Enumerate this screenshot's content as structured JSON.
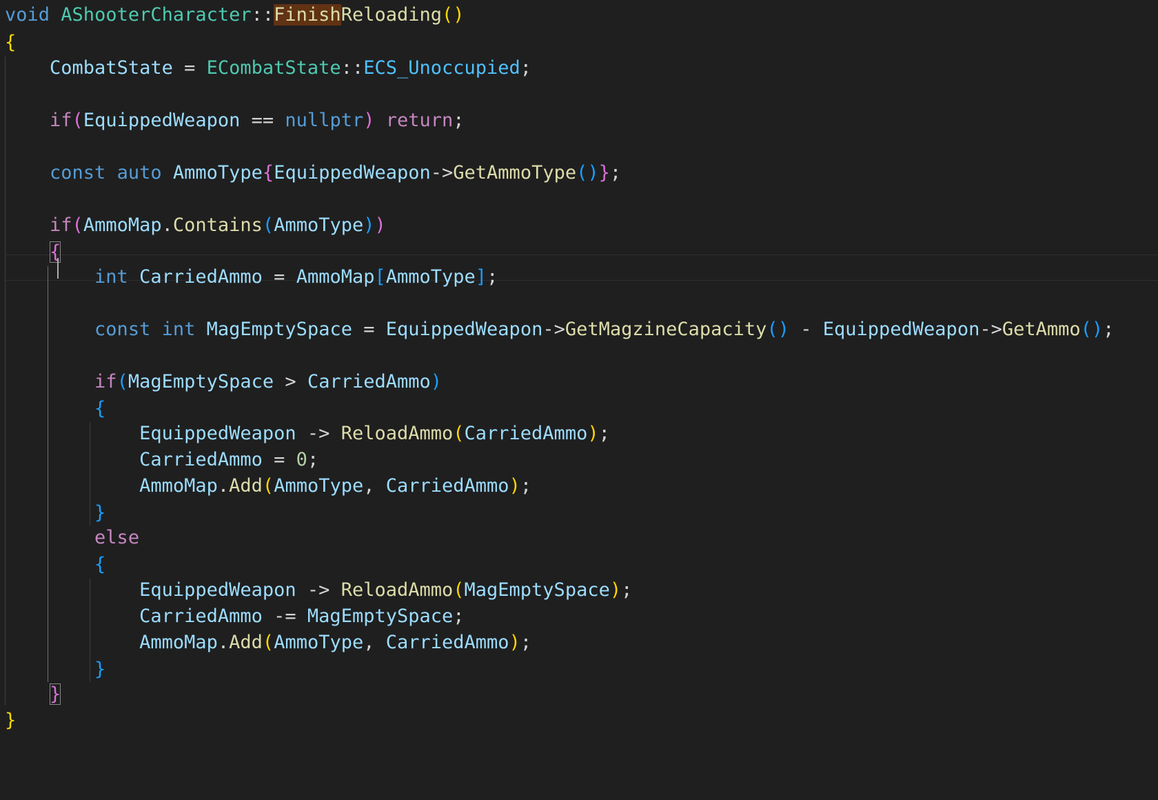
{
  "colors": {
    "background": "#1f1f1f",
    "keyword": "#569cd6",
    "control": "#c586c0",
    "type": "#4ec9b0",
    "function": "#dcdcaa",
    "variable": "#9cdcfe",
    "enum_member": "#4fc1ff",
    "number": "#b5cea8",
    "operator": "#d4d4d4",
    "bracket_gold": "#ffd700",
    "bracket_pink": "#da70d6",
    "bracket_blue": "#179fff",
    "find_highlight": "#613214"
  },
  "code": {
    "lines": [
      {
        "tokens": [
          {
            "t": "void",
            "c": "keyword"
          },
          {
            "t": " "
          },
          {
            "t": "AShooterCharacter",
            "c": "type"
          },
          {
            "t": "::",
            "c": "operator"
          },
          {
            "t": "Finish",
            "c": "function",
            "h": 1
          },
          {
            "t": "Reloading",
            "c": "function"
          },
          {
            "t": "()",
            "c": "bracket_gold"
          }
        ]
      },
      {
        "tokens": [
          {
            "t": "{",
            "c": "bracket_gold"
          }
        ]
      },
      {
        "tokens": [
          {
            "t": "    "
          },
          {
            "t": "CombatState",
            "c": "variable"
          },
          {
            "t": " = ",
            "c": "operator"
          },
          {
            "t": "ECombatState",
            "c": "type"
          },
          {
            "t": "::",
            "c": "operator"
          },
          {
            "t": "ECS_Unoccupied",
            "c": "enum_member"
          },
          {
            "t": ";",
            "c": "operator"
          }
        ]
      },
      {
        "tokens": []
      },
      {
        "tokens": [
          {
            "t": "    "
          },
          {
            "t": "if",
            "c": "control"
          },
          {
            "t": "(",
            "c": "bracket_pink"
          },
          {
            "t": "EquippedWeapon",
            "c": "variable"
          },
          {
            "t": " == ",
            "c": "operator"
          },
          {
            "t": "nullptr",
            "c": "keyword"
          },
          {
            "t": ")",
            "c": "bracket_pink"
          },
          {
            "t": " "
          },
          {
            "t": "return",
            "c": "control"
          },
          {
            "t": ";",
            "c": "operator"
          }
        ]
      },
      {
        "tokens": []
      },
      {
        "tokens": [
          {
            "t": "    "
          },
          {
            "t": "const",
            "c": "keyword"
          },
          {
            "t": " "
          },
          {
            "t": "auto",
            "c": "keyword"
          },
          {
            "t": " "
          },
          {
            "t": "AmmoType",
            "c": "variable"
          },
          {
            "t": "{",
            "c": "bracket_pink"
          },
          {
            "t": "EquippedWeapon",
            "c": "variable"
          },
          {
            "t": "->",
            "c": "operator"
          },
          {
            "t": "GetAmmoType",
            "c": "function"
          },
          {
            "t": "()",
            "c": "bracket_blue"
          },
          {
            "t": "}",
            "c": "bracket_pink"
          },
          {
            "t": ";",
            "c": "operator"
          }
        ]
      },
      {
        "tokens": []
      },
      {
        "tokens": [
          {
            "t": "    "
          },
          {
            "t": "if",
            "c": "control"
          },
          {
            "t": "(",
            "c": "bracket_pink"
          },
          {
            "t": "AmmoMap",
            "c": "variable"
          },
          {
            "t": ".",
            "c": "operator"
          },
          {
            "t": "Contains",
            "c": "function"
          },
          {
            "t": "(",
            "c": "bracket_blue"
          },
          {
            "t": "AmmoType",
            "c": "variable"
          },
          {
            "t": ")",
            "c": "bracket_blue"
          },
          {
            "t": ")",
            "c": "bracket_pink"
          }
        ]
      },
      {
        "tokens": [
          {
            "t": "    "
          },
          {
            "t": "{",
            "c": "bracket_pink",
            "box": 1
          }
        ]
      },
      {
        "tokens": [
          {
            "t": "        "
          },
          {
            "t": "int",
            "c": "keyword"
          },
          {
            "t": " "
          },
          {
            "t": "CarriedAmmo",
            "c": "variable"
          },
          {
            "t": " = ",
            "c": "operator"
          },
          {
            "t": "AmmoMap",
            "c": "variable"
          },
          {
            "t": "[",
            "c": "bracket_blue"
          },
          {
            "t": "AmmoType",
            "c": "variable"
          },
          {
            "t": "]",
            "c": "bracket_blue"
          },
          {
            "t": ";",
            "c": "operator"
          }
        ]
      },
      {
        "tokens": []
      },
      {
        "tokens": [
          {
            "t": "        "
          },
          {
            "t": "const",
            "c": "keyword"
          },
          {
            "t": " "
          },
          {
            "t": "int",
            "c": "keyword"
          },
          {
            "t": " "
          },
          {
            "t": "MagEmptySpace",
            "c": "variable"
          },
          {
            "t": " = ",
            "c": "operator"
          },
          {
            "t": "EquippedWeapon",
            "c": "variable"
          },
          {
            "t": "->",
            "c": "operator"
          },
          {
            "t": "GetMagzineCapacity",
            "c": "function"
          },
          {
            "t": "()",
            "c": "bracket_blue"
          },
          {
            "t": " - ",
            "c": "operator"
          },
          {
            "t": "EquippedWeapon",
            "c": "variable"
          },
          {
            "t": "->",
            "c": "operator"
          },
          {
            "t": "GetAmmo",
            "c": "function"
          },
          {
            "t": "()",
            "c": "bracket_blue"
          },
          {
            "t": ";",
            "c": "operator"
          }
        ]
      },
      {
        "tokens": []
      },
      {
        "tokens": [
          {
            "t": "        "
          },
          {
            "t": "if",
            "c": "control"
          },
          {
            "t": "(",
            "c": "bracket_blue"
          },
          {
            "t": "MagEmptySpace",
            "c": "variable"
          },
          {
            "t": " > ",
            "c": "operator"
          },
          {
            "t": "CarriedAmmo",
            "c": "variable"
          },
          {
            "t": ")",
            "c": "bracket_blue"
          }
        ]
      },
      {
        "tokens": [
          {
            "t": "        "
          },
          {
            "t": "{",
            "c": "bracket_blue"
          }
        ]
      },
      {
        "tokens": [
          {
            "t": "            "
          },
          {
            "t": "EquippedWeapon",
            "c": "variable"
          },
          {
            "t": " -> ",
            "c": "operator"
          },
          {
            "t": "ReloadAmmo",
            "c": "function"
          },
          {
            "t": "(",
            "c": "bracket_gold"
          },
          {
            "t": "CarriedAmmo",
            "c": "variable"
          },
          {
            "t": ")",
            "c": "bracket_gold"
          },
          {
            "t": ";",
            "c": "operator"
          }
        ]
      },
      {
        "tokens": [
          {
            "t": "            "
          },
          {
            "t": "CarriedAmmo",
            "c": "variable"
          },
          {
            "t": " = ",
            "c": "operator"
          },
          {
            "t": "0",
            "c": "number"
          },
          {
            "t": ";",
            "c": "operator"
          }
        ]
      },
      {
        "tokens": [
          {
            "t": "            "
          },
          {
            "t": "AmmoMap",
            "c": "variable"
          },
          {
            "t": ".",
            "c": "operator"
          },
          {
            "t": "Add",
            "c": "function"
          },
          {
            "t": "(",
            "c": "bracket_gold"
          },
          {
            "t": "AmmoType",
            "c": "variable"
          },
          {
            "t": ", ",
            "c": "operator"
          },
          {
            "t": "CarriedAmmo",
            "c": "variable"
          },
          {
            "t": ")",
            "c": "bracket_gold"
          },
          {
            "t": ";",
            "c": "operator"
          }
        ]
      },
      {
        "tokens": [
          {
            "t": "        "
          },
          {
            "t": "}",
            "c": "bracket_blue"
          }
        ]
      },
      {
        "tokens": [
          {
            "t": "        "
          },
          {
            "t": "else",
            "c": "control"
          }
        ]
      },
      {
        "tokens": [
          {
            "t": "        "
          },
          {
            "t": "{",
            "c": "bracket_blue"
          }
        ]
      },
      {
        "tokens": [
          {
            "t": "            "
          },
          {
            "t": "EquippedWeapon",
            "c": "variable"
          },
          {
            "t": " -> ",
            "c": "operator"
          },
          {
            "t": "ReloadAmmo",
            "c": "function"
          },
          {
            "t": "(",
            "c": "bracket_gold"
          },
          {
            "t": "MagEmptySpace",
            "c": "variable"
          },
          {
            "t": ")",
            "c": "bracket_gold"
          },
          {
            "t": ";",
            "c": "operator"
          }
        ]
      },
      {
        "tokens": [
          {
            "t": "            "
          },
          {
            "t": "CarriedAmmo",
            "c": "variable"
          },
          {
            "t": " -= ",
            "c": "operator"
          },
          {
            "t": "MagEmptySpace",
            "c": "variable"
          },
          {
            "t": ";",
            "c": "operator"
          }
        ]
      },
      {
        "tokens": [
          {
            "t": "            "
          },
          {
            "t": "AmmoMap",
            "c": "variable"
          },
          {
            "t": ".",
            "c": "operator"
          },
          {
            "t": "Add",
            "c": "function"
          },
          {
            "t": "(",
            "c": "bracket_gold"
          },
          {
            "t": "AmmoType",
            "c": "variable"
          },
          {
            "t": ", ",
            "c": "operator"
          },
          {
            "t": "CarriedAmmo",
            "c": "variable"
          },
          {
            "t": ")",
            "c": "bracket_gold"
          },
          {
            "t": ";",
            "c": "operator"
          }
        ]
      },
      {
        "tokens": [
          {
            "t": "        "
          },
          {
            "t": "}",
            "c": "bracket_blue"
          }
        ]
      },
      {
        "tokens": [
          {
            "t": "    "
          },
          {
            "t": "}",
            "c": "bracket_pink",
            "box": 1
          }
        ]
      },
      {
        "tokens": [
          {
            "t": "}",
            "c": "bracket_gold"
          }
        ]
      }
    ]
  }
}
